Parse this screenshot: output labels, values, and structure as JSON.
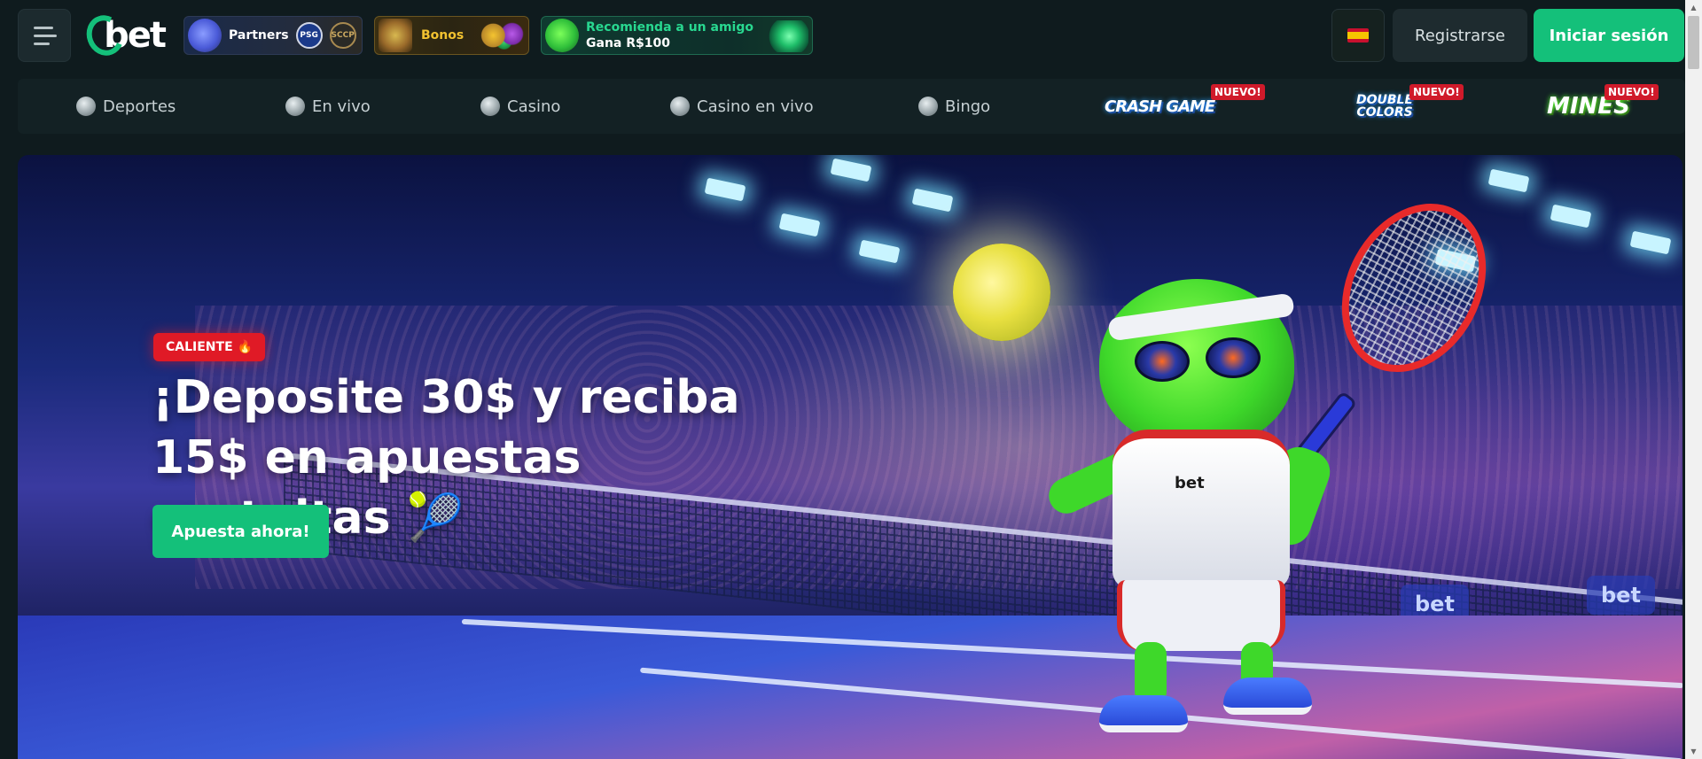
{
  "header": {
    "logo_text": "bet",
    "promos": {
      "partners_label": "Partners",
      "psg_label": "PSG",
      "corinthians_label": "SCCP",
      "bonos_label": "Bonos",
      "refer_line1": "Recomienda a un amigo",
      "refer_line2": "Gana R$100"
    },
    "language_flag": "es-flag-icon",
    "register_label": "Registrarse",
    "login_label": "Iniciar sesión"
  },
  "nav": {
    "categories": [
      {
        "label": "Deportes",
        "icon": "soccer-ball-icon"
      },
      {
        "label": "En vivo",
        "icon": "live-ticket-icon"
      },
      {
        "label": "Casino",
        "icon": "slot-machine-icon"
      },
      {
        "label": "Casino en vivo",
        "icon": "roulette-icon"
      },
      {
        "label": "Bingo",
        "icon": "bingo-ball-icon"
      }
    ],
    "games": [
      {
        "label": "CRASH GAME",
        "badge": "NUEVO!"
      },
      {
        "label_line1": "DOUBLE",
        "label_line2": "COLORS",
        "badge": "NUEVO!"
      },
      {
        "label": "MINES",
        "badge": "NUEVO!"
      }
    ]
  },
  "hero": {
    "badge": "CALIENTE 🔥",
    "title": "¡Deposite 30$ y reciba 15$ en apuestas gratuitas 🎾",
    "cta": "Apuesta ahora!",
    "shirt_logo": "bet",
    "board_logo": "bet"
  },
  "colors": {
    "accent": "#14c07a",
    "background": "#0f1b1e",
    "badge_red": "#e01a26"
  }
}
